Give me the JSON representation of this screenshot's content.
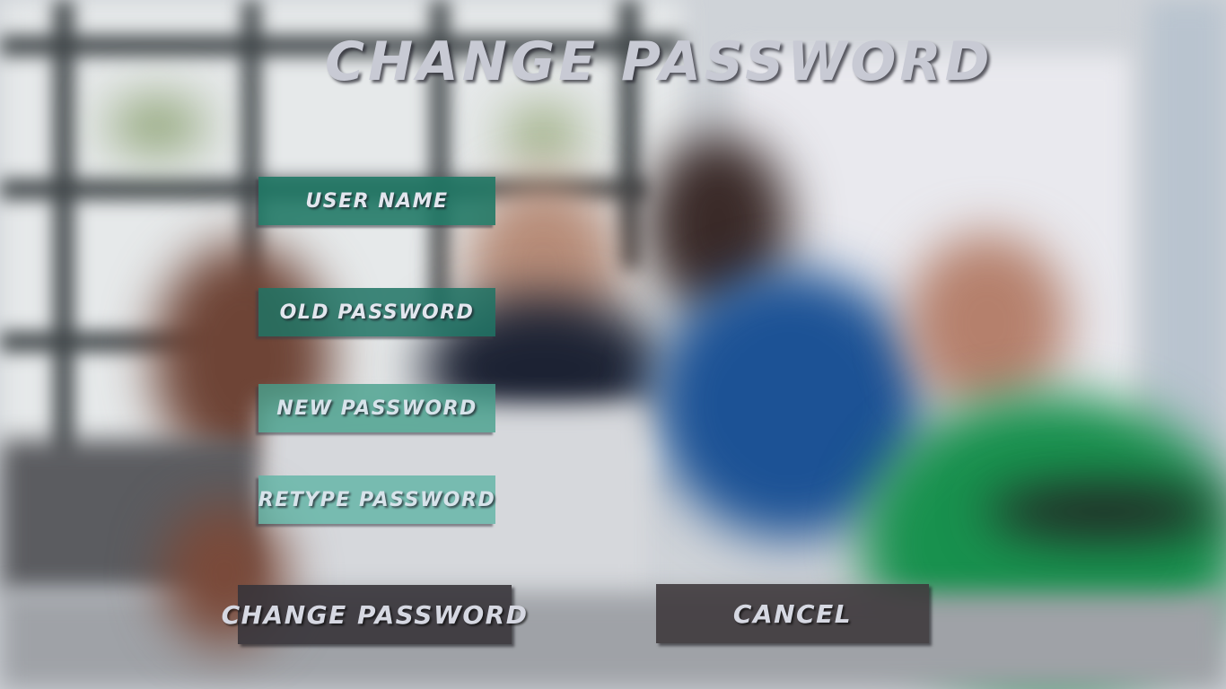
{
  "title": "CHANGE PASSWORD",
  "fields": [
    {
      "label": "USER NAME"
    },
    {
      "label": "OLD PASSWORD"
    },
    {
      "label": "NEW PASSWORD"
    },
    {
      "label": "RETYPE PASSWORD"
    }
  ],
  "buttons": {
    "change_password": "CHANGE PASSWORD",
    "cancel": "CANCEL"
  },
  "colors": {
    "field_teal": "#1e7864",
    "field_light_teal": "#5fb4a5",
    "button_dark": "#37343a",
    "title_text": "#c8cad4"
  }
}
